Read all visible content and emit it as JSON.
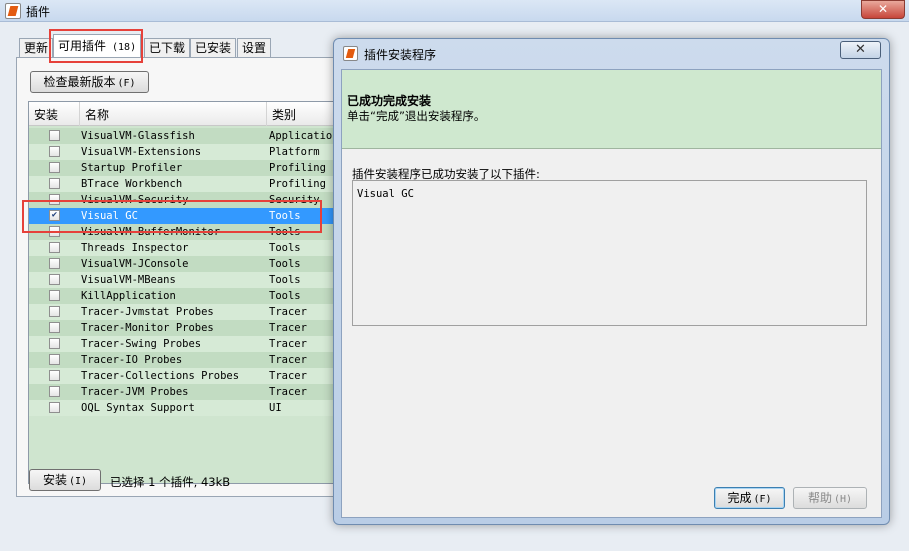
{
  "outer_window": {
    "title": "插件",
    "close_glyph": "✕"
  },
  "tabs": [
    {
      "label": "更新"
    },
    {
      "label": "可用插件",
      "count": "(18)"
    },
    {
      "label": "已下载"
    },
    {
      "label": "已安装"
    },
    {
      "label": "设置"
    }
  ],
  "buttons": {
    "check_updates": "检查最新版本",
    "check_updates_hint": "(F)",
    "install": "安装",
    "install_hint": "(I)"
  },
  "table": {
    "columns": [
      "安装",
      "名称",
      "类别"
    ],
    "rows": [
      {
        "checked": false,
        "name": "VisualVM-Glassfish",
        "category": "Application"
      },
      {
        "checked": false,
        "name": "VisualVM-Extensions",
        "category": "Platform"
      },
      {
        "checked": false,
        "name": "Startup Profiler",
        "category": "Profiling"
      },
      {
        "checked": false,
        "name": "BTrace Workbench",
        "category": "Profiling"
      },
      {
        "checked": false,
        "name": "VisualVM-Security",
        "category": "Security"
      },
      {
        "checked": true,
        "name": "Visual GC",
        "category": "Tools",
        "selected": true
      },
      {
        "checked": false,
        "name": "VisualVM-BufferMonitor",
        "category": "Tools"
      },
      {
        "checked": false,
        "name": "Threads Inspector",
        "category": "Tools"
      },
      {
        "checked": false,
        "name": "VisualVM-JConsole",
        "category": "Tools"
      },
      {
        "checked": false,
        "name": "VisualVM-MBeans",
        "category": "Tools"
      },
      {
        "checked": false,
        "name": "KillApplication",
        "category": "Tools"
      },
      {
        "checked": false,
        "name": "Tracer-Jvmstat Probes",
        "category": "Tracer"
      },
      {
        "checked": false,
        "name": "Tracer-Monitor Probes",
        "category": "Tracer"
      },
      {
        "checked": false,
        "name": "Tracer-Swing Probes",
        "category": "Tracer"
      },
      {
        "checked": false,
        "name": "Tracer-IO Probes",
        "category": "Tracer"
      },
      {
        "checked": false,
        "name": "Tracer-Collections Probes",
        "category": "Tracer"
      },
      {
        "checked": false,
        "name": "Tracer-JVM Probes",
        "category": "Tracer"
      },
      {
        "checked": false,
        "name": "OQL Syntax Support",
        "category": "UI"
      }
    ]
  },
  "status": "已选择 1 个插件, 43kB",
  "dialog": {
    "title": "插件安装程序",
    "close_glyph": "✕",
    "heading": "已成功完成安装",
    "subtext": "单击“完成”退出安装程序。",
    "result_label": "插件安装程序已成功安装了以下插件:",
    "result_content": "Visual GC",
    "finish_label": "完成",
    "finish_hint": "(F)",
    "help_label": "帮助",
    "help_hint": "(H)"
  },
  "colors": {
    "row_green": "#d6ead6",
    "row_green_alt": "#c2dcc2",
    "selected_row": "#3399ff",
    "annotation_red": "#e6413a",
    "dialog_header": "#cfe8cf"
  }
}
